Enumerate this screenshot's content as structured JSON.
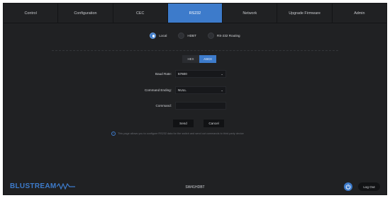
{
  "tabs": [
    "Control",
    "Configuration",
    "CEC",
    "RS232",
    "Network",
    "Upgrade Firmware",
    "Admin"
  ],
  "active_tab": "RS232",
  "mode": {
    "options": [
      "Local",
      "HDBT",
      "RS-232 Routing"
    ],
    "selected": "Local"
  },
  "format": {
    "options": [
      "HEX",
      "ASCII"
    ],
    "selected": "ASCII"
  },
  "form": {
    "baud_rate_label": "Baud Rate",
    "baud_rate_value": "57600",
    "command_ending_label": "Command Ending",
    "command_ending_value": "NULL",
    "command_label": "Command",
    "command_value": "",
    "command_placeholder": ""
  },
  "buttons": {
    "send": "Send",
    "cancel": "Cancel"
  },
  "info_text": "This page allows you to configure RS232 data for the switch and send out commands to third party device",
  "footer": {
    "brand": "BLUSTREAM",
    "model": "SW41HDBT",
    "logout": "Log Out"
  },
  "colors": {
    "accent": "#3d7bcb",
    "background": "#202123"
  }
}
